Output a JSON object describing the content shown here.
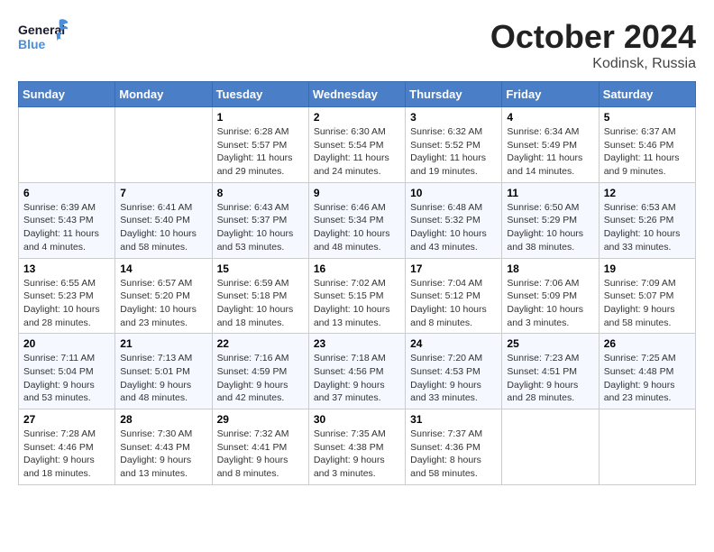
{
  "header": {
    "logo_general": "General",
    "logo_blue": "Blue",
    "month": "October 2024",
    "location": "Kodinsk, Russia"
  },
  "weekdays": [
    "Sunday",
    "Monday",
    "Tuesday",
    "Wednesday",
    "Thursday",
    "Friday",
    "Saturday"
  ],
  "weeks": [
    [
      {
        "day": "",
        "info": ""
      },
      {
        "day": "",
        "info": ""
      },
      {
        "day": "1",
        "sunrise": "6:28 AM",
        "sunset": "5:57 PM",
        "daylight": "11 hours and 29 minutes."
      },
      {
        "day": "2",
        "sunrise": "6:30 AM",
        "sunset": "5:54 PM",
        "daylight": "11 hours and 24 minutes."
      },
      {
        "day": "3",
        "sunrise": "6:32 AM",
        "sunset": "5:52 PM",
        "daylight": "11 hours and 19 minutes."
      },
      {
        "day": "4",
        "sunrise": "6:34 AM",
        "sunset": "5:49 PM",
        "daylight": "11 hours and 14 minutes."
      },
      {
        "day": "5",
        "sunrise": "6:37 AM",
        "sunset": "5:46 PM",
        "daylight": "11 hours and 9 minutes."
      }
    ],
    [
      {
        "day": "6",
        "sunrise": "6:39 AM",
        "sunset": "5:43 PM",
        "daylight": "11 hours and 4 minutes."
      },
      {
        "day": "7",
        "sunrise": "6:41 AM",
        "sunset": "5:40 PM",
        "daylight": "10 hours and 58 minutes."
      },
      {
        "day": "8",
        "sunrise": "6:43 AM",
        "sunset": "5:37 PM",
        "daylight": "10 hours and 53 minutes."
      },
      {
        "day": "9",
        "sunrise": "6:46 AM",
        "sunset": "5:34 PM",
        "daylight": "10 hours and 48 minutes."
      },
      {
        "day": "10",
        "sunrise": "6:48 AM",
        "sunset": "5:32 PM",
        "daylight": "10 hours and 43 minutes."
      },
      {
        "day": "11",
        "sunrise": "6:50 AM",
        "sunset": "5:29 PM",
        "daylight": "10 hours and 38 minutes."
      },
      {
        "day": "12",
        "sunrise": "6:53 AM",
        "sunset": "5:26 PM",
        "daylight": "10 hours and 33 minutes."
      }
    ],
    [
      {
        "day": "13",
        "sunrise": "6:55 AM",
        "sunset": "5:23 PM",
        "daylight": "10 hours and 28 minutes."
      },
      {
        "day": "14",
        "sunrise": "6:57 AM",
        "sunset": "5:20 PM",
        "daylight": "10 hours and 23 minutes."
      },
      {
        "day": "15",
        "sunrise": "6:59 AM",
        "sunset": "5:18 PM",
        "daylight": "10 hours and 18 minutes."
      },
      {
        "day": "16",
        "sunrise": "7:02 AM",
        "sunset": "5:15 PM",
        "daylight": "10 hours and 13 minutes."
      },
      {
        "day": "17",
        "sunrise": "7:04 AM",
        "sunset": "5:12 PM",
        "daylight": "10 hours and 8 minutes."
      },
      {
        "day": "18",
        "sunrise": "7:06 AM",
        "sunset": "5:09 PM",
        "daylight": "10 hours and 3 minutes."
      },
      {
        "day": "19",
        "sunrise": "7:09 AM",
        "sunset": "5:07 PM",
        "daylight": "9 hours and 58 minutes."
      }
    ],
    [
      {
        "day": "20",
        "sunrise": "7:11 AM",
        "sunset": "5:04 PM",
        "daylight": "9 hours and 53 minutes."
      },
      {
        "day": "21",
        "sunrise": "7:13 AM",
        "sunset": "5:01 PM",
        "daylight": "9 hours and 48 minutes."
      },
      {
        "day": "22",
        "sunrise": "7:16 AM",
        "sunset": "4:59 PM",
        "daylight": "9 hours and 42 minutes."
      },
      {
        "day": "23",
        "sunrise": "7:18 AM",
        "sunset": "4:56 PM",
        "daylight": "9 hours and 37 minutes."
      },
      {
        "day": "24",
        "sunrise": "7:20 AM",
        "sunset": "4:53 PM",
        "daylight": "9 hours and 33 minutes."
      },
      {
        "day": "25",
        "sunrise": "7:23 AM",
        "sunset": "4:51 PM",
        "daylight": "9 hours and 28 minutes."
      },
      {
        "day": "26",
        "sunrise": "7:25 AM",
        "sunset": "4:48 PM",
        "daylight": "9 hours and 23 minutes."
      }
    ],
    [
      {
        "day": "27",
        "sunrise": "7:28 AM",
        "sunset": "4:46 PM",
        "daylight": "9 hours and 18 minutes."
      },
      {
        "day": "28",
        "sunrise": "7:30 AM",
        "sunset": "4:43 PM",
        "daylight": "9 hours and 13 minutes."
      },
      {
        "day": "29",
        "sunrise": "7:32 AM",
        "sunset": "4:41 PM",
        "daylight": "9 hours and 8 minutes."
      },
      {
        "day": "30",
        "sunrise": "7:35 AM",
        "sunset": "4:38 PM",
        "daylight": "9 hours and 3 minutes."
      },
      {
        "day": "31",
        "sunrise": "7:37 AM",
        "sunset": "4:36 PM",
        "daylight": "8 hours and 58 minutes."
      },
      {
        "day": "",
        "info": ""
      },
      {
        "day": "",
        "info": ""
      }
    ]
  ],
  "labels": {
    "sunrise": "Sunrise: ",
    "sunset": "Sunset: ",
    "daylight": "Daylight: "
  }
}
